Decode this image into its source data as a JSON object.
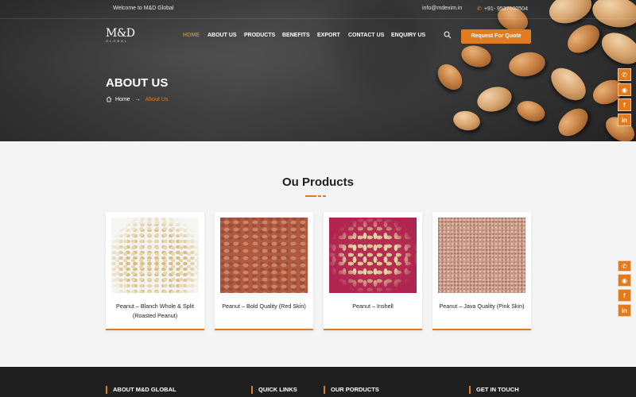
{
  "colors": {
    "accent": "#e07b1f",
    "hero_bg": "#3a3a3a",
    "footer_bg": "#1f1f1f",
    "page_bg": "#f4f4f4"
  },
  "topbar": {
    "welcome": "Welcome to M&D Global",
    "email": "info@mdexim.in",
    "phone_icon": "phone-icon",
    "phone": "+91- 9537500504"
  },
  "logo": {
    "mark": "M&D",
    "sub": "GLOBAL"
  },
  "nav": {
    "items": [
      {
        "label": "HOME",
        "active": true
      },
      {
        "label": "ABOUT US"
      },
      {
        "label": "PRODUCTS"
      },
      {
        "label": "BENEFITS"
      },
      {
        "label": "EXPORT"
      },
      {
        "label": "CONTACT US"
      },
      {
        "label": "ENQUIRY US"
      }
    ],
    "search_icon": "search-icon",
    "quote_button": "Request For Quote"
  },
  "hero": {
    "title": "ABOUT US",
    "breadcrumb": {
      "home": "Home",
      "arrow": "→",
      "current": "About Us"
    }
  },
  "social": {
    "top": [
      {
        "icon": "phone-icon",
        "glyph": "✆"
      },
      {
        "icon": "whatsapp-icon",
        "glyph": "◉"
      },
      {
        "icon": "facebook-icon",
        "glyph": "f"
      },
      {
        "icon": "linkedin-icon",
        "glyph": "in"
      }
    ],
    "bottom": [
      {
        "icon": "phone-icon",
        "glyph": "✆"
      },
      {
        "icon": "whatsapp-icon",
        "glyph": "◉"
      },
      {
        "icon": "facebook-icon",
        "glyph": "f"
      },
      {
        "icon": "linkedin-icon",
        "glyph": "in"
      }
    ]
  },
  "products": {
    "title": "Ou Products",
    "items": [
      {
        "name": "Peanut – Blanch Whole & Split (Roasted Peanut)",
        "image": "blanched-peanuts"
      },
      {
        "name": "Peanut – Bold Quality (Red Skin)",
        "image": "red-skin-peanuts"
      },
      {
        "name": "Peanut – Inshell",
        "image": "inshell-peanuts"
      },
      {
        "name": "Peanut – Java Quality (Pink Skin)",
        "image": "pink-skin-peanuts"
      }
    ]
  },
  "footer": {
    "columns": [
      "ABOUT M&D GLOBAL",
      "QUICK LINKS",
      "OUR PORDUCTS",
      "GET IN TOUCH"
    ]
  }
}
